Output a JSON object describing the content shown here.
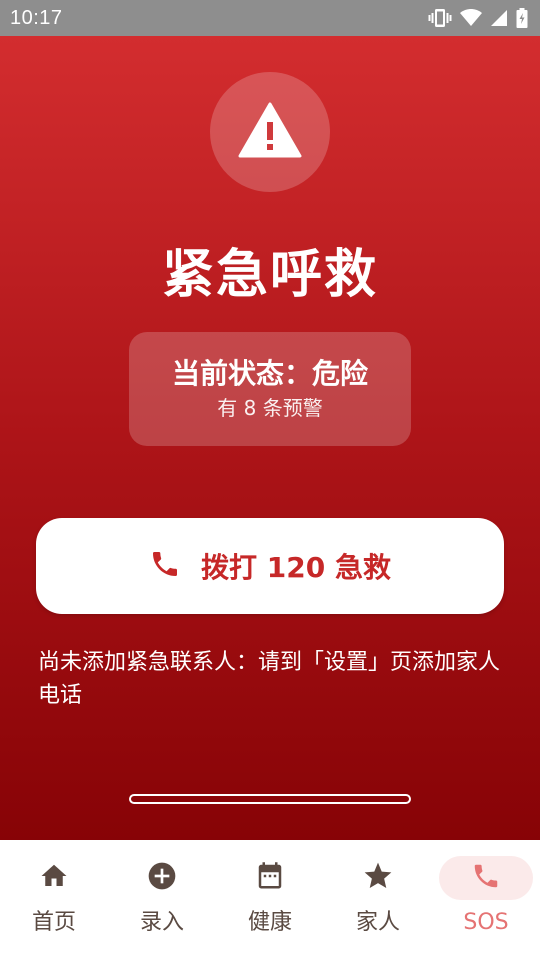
{
  "status_bar": {
    "time": "10:17"
  },
  "main": {
    "title": "紧急呼救",
    "status_card": {
      "state": "当前状态：危险",
      "warnings": "有 8 条预警"
    },
    "call_button": {
      "label": "拨打 120 急救"
    },
    "notice": "尚未添加紧急联系人：请到「设置」页添加家人电话"
  },
  "bottom_nav": {
    "items": [
      {
        "label": "首页",
        "icon": "home-icon"
      },
      {
        "label": "录入",
        "icon": "add-circle-icon"
      },
      {
        "label": "健康",
        "icon": "calendar-icon"
      },
      {
        "label": "家人",
        "icon": "star-icon"
      },
      {
        "label": "SOS",
        "icon": "phone-icon",
        "active": true
      }
    ]
  },
  "colors": {
    "gradient_top": "#d32d2f",
    "gradient_bottom": "#870306",
    "accent_red": "#c62828",
    "nav_active": "#e57373",
    "nav_active_bg": "#fbeaea",
    "nav_inactive": "#5a4a42"
  }
}
